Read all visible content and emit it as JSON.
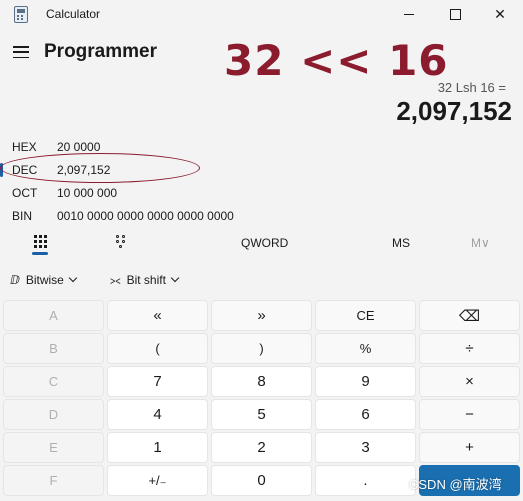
{
  "window": {
    "title": "Calculator"
  },
  "header": {
    "mode": "Programmer",
    "annotation": "32 << 16",
    "expression": "32 Lsh 16 =",
    "result": "2,097,152"
  },
  "radix": [
    {
      "label": "HEX",
      "value": "20 0000"
    },
    {
      "label": "DEC",
      "value": "2,097,152"
    },
    {
      "label": "OCT",
      "value": "10 000 000"
    },
    {
      "label": "BIN",
      "value": "0010 0000 0000 0000 0000 0000"
    }
  ],
  "tabs": {
    "word_size": "QWORD",
    "memory_store": "MS",
    "memory_menu": "M∨"
  },
  "toolbar": {
    "bitwise": "Bitwise",
    "bitshift": "Bit shift"
  },
  "keys": {
    "A": "A",
    "B": "B",
    "C": "C",
    "D": "D",
    "E": "E",
    "F": "F",
    "shift_left": "«",
    "shift_right": "»",
    "clear_entry": "CE",
    "backspace": "⌫",
    "open_paren": "(",
    "close_paren": ")",
    "mod": "%",
    "divide": "÷",
    "n7": "7",
    "n8": "8",
    "n9": "9",
    "multiply": "×",
    "n4": "4",
    "n5": "5",
    "n6": "6",
    "minus": "−",
    "n1": "1",
    "n2": "2",
    "n3": "3",
    "plus": "+",
    "negate": "+/₋",
    "n0": "0",
    "decimal": "."
  },
  "watermark": "CSDN @南波湾",
  "colors": {
    "accent": "#1a6fb0",
    "annotation": "#8b1c2e"
  }
}
